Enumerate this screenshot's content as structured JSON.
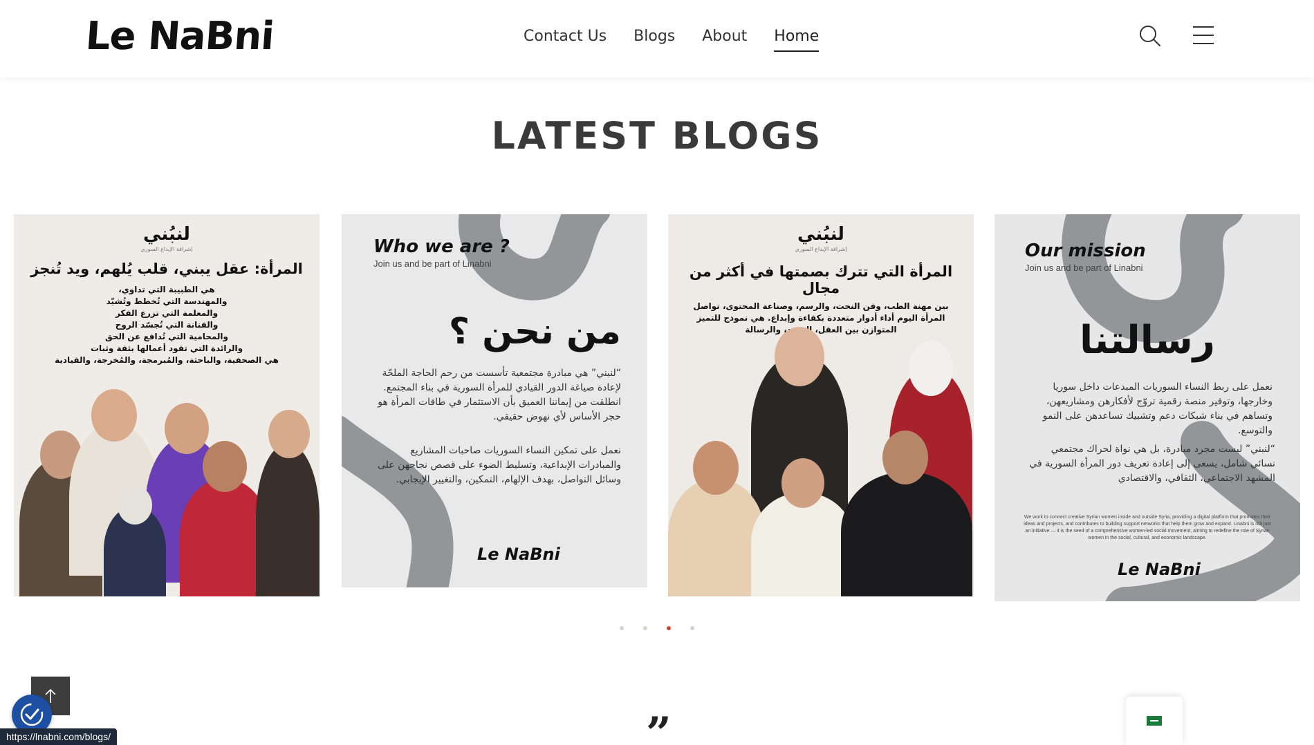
{
  "header": {
    "logo": "Le NaBni",
    "nav": [
      "Contact Us",
      "Blogs",
      "About",
      "Home"
    ],
    "active_nav": "Home"
  },
  "section": {
    "title": "LATEST BLOGS"
  },
  "cards": [
    {
      "brand_ar": "لنبُني",
      "brand_sub": "إشراقة الإبداع السوري",
      "headline": "المرأة: عقل يبني، قلب يُلهم، ويد تُنجز",
      "lines": [
        "هي الطبيبة التي تداوي،",
        "والمهندسة التي تُخطط وتُشيّد",
        "والمعلمة التي تزرع الفكر",
        "والفنانة التي تُجسّد الروح",
        "والمحامية التي تُدافع عن الحق",
        "والرائدة التي تقود أعمالها بثقة وثبات",
        "هي الصحفية، والباحثة، والمُبرمجة، والمُخرجة، والقيادية"
      ]
    },
    {
      "en_heading": "Who we are ?",
      "en_sub": "Join us and be part of Linabni",
      "ar_heading": "من نحن ؟",
      "para1": "“لنبني” هي مبادرة مجتمعية تأسست من رحم الحاجة الملحّة لإعادة صياغة الدور القيادي للمرأة السورية في بناء المجتمع. انطلقت من إيماننا العميق بأن الاستثمار في طاقات المرأة هو حجر الأساس لأي نهوض حقيقي.",
      "para2": "نعمل على تمكين النساء السوريات صاحبات المشاريع والمبادرات الإبداعية، وتسليط الضوء على قصص نجاحهن على وسائل التواصل، بهدف الإلهام، التمكين، والتغيير الإيجابي.",
      "signature": "Le NaBni"
    },
    {
      "brand_ar": "لنبُني",
      "brand_sub": "إشراقة الإبداع السوري",
      "headline": "المرأة التي تترك بصمتها في أكثر من مجال",
      "lines": [
        "بين مهنة الطب، وفن النحت، والرسم، وصناعة المحتوى، تواصل",
        "المرأة اليوم أداء أدوار متعددة بكفاءة وإبداع. هي نموذج للتميز",
        "المتوازن بين العقل، الجسد، والرسالة"
      ]
    },
    {
      "en_heading": "Our mission",
      "en_sub": "Join us and be part of Linabni",
      "ar_heading": "رسالتنا",
      "para1": "نعمل على ربط النساء السوريات المبدعات داخل سوريا وخارجها، وتوفير منصة رقمية تروّج لأفكارهن ومشاريعهن، وتساهم في بناء شبكات دعم وتشبيك تساعدهن على النمو والتوسع.",
      "para2": "“لنبني” ليست مجرد مبادرة، بل هي نواة لحراك مجتمعي نسائي شامل، يسعى إلى إعادة تعريف دور المرأة السورية في المشهد الاجتماعي، الثقافي، والاقتصادي",
      "para_en": "We work to connect creative Syrian women inside and outside Syria, providing a digital platform that promotes their ideas and projects, and contributes to building support networks that help them grow and expand. Linabni is not just an initiative — it is the seed of a comprehensive women-led social movement, aiming to redefine the role of Syrian women in the social, cultural, and economic landscape.",
      "signature": "Le NaBni"
    }
  ],
  "pagination": {
    "count": 4,
    "active": 2
  },
  "status_url": "https://lnabni.com/blogs/",
  "quote_glyph": "”",
  "colors": {
    "accent": "#c84a2f",
    "access": "#1d4fa3",
    "dark": "#3d3d3d",
    "swirl": "#8a8c8f"
  }
}
